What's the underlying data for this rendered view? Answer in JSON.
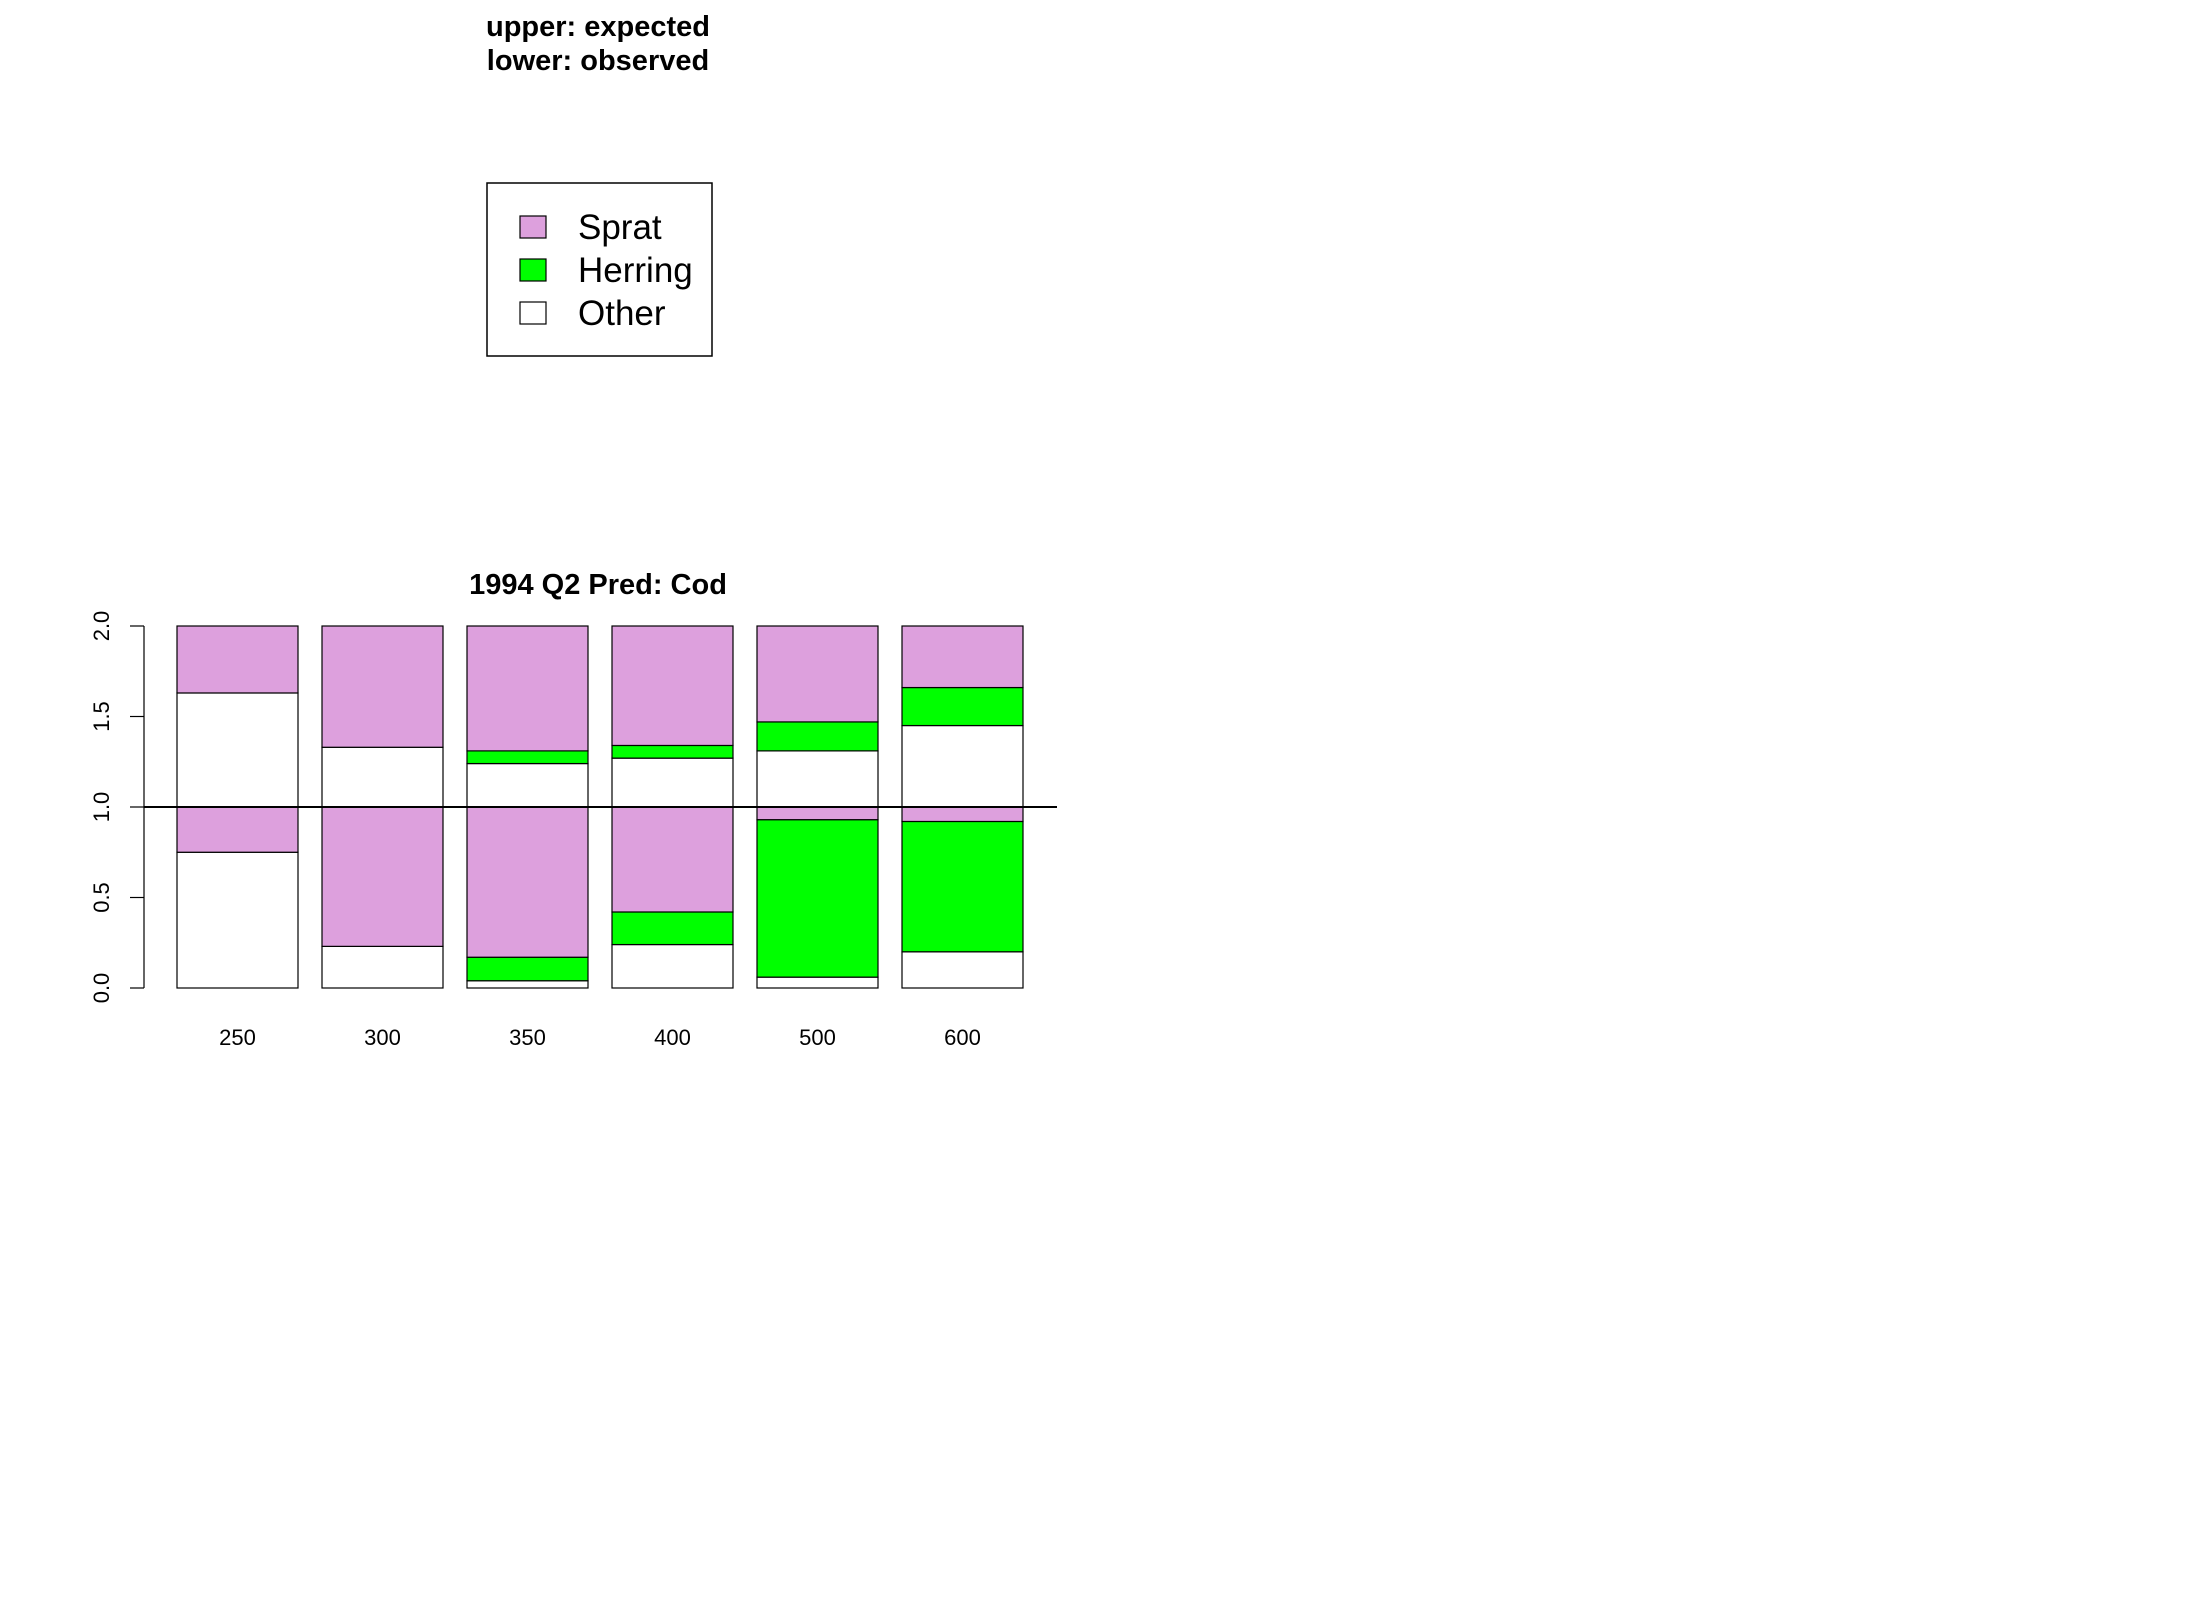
{
  "header": {
    "line1": "upper: expected",
    "line2": "lower: observed"
  },
  "legend": {
    "items": [
      {
        "label": "Sprat",
        "color": "#dda0dd"
      },
      {
        "label": "Herring",
        "color": "#00ff00"
      },
      {
        "label": "Other",
        "color": "#ffffff"
      }
    ]
  },
  "chart_data": {
    "type": "bar",
    "title": "1994 Q2  Pred: Cod",
    "xlabel": "",
    "ylabel": "",
    "ylim": [
      0,
      2
    ],
    "yticks": [
      "0.0",
      "0.5",
      "1.0",
      "1.5",
      "2.0"
    ],
    "reference_line": 1.0,
    "categories": [
      "250",
      "300",
      "350",
      "400",
      "500",
      "600"
    ],
    "stack_order": [
      "Other",
      "Herring",
      "Sprat"
    ],
    "expected": [
      {
        "name": "Other",
        "values": [
          0.63,
          0.33,
          0.24,
          0.27,
          0.31,
          0.45
        ]
      },
      {
        "name": "Herring",
        "values": [
          0.0,
          0.0,
          0.07,
          0.07,
          0.16,
          0.21
        ]
      },
      {
        "name": "Sprat",
        "values": [
          0.37,
          0.67,
          0.69,
          0.66,
          0.53,
          0.34
        ]
      }
    ],
    "observed": [
      {
        "name": "Other",
        "values": [
          0.75,
          0.23,
          0.04,
          0.24,
          0.06,
          0.2
        ]
      },
      {
        "name": "Herring",
        "values": [
          0.0,
          0.0,
          0.13,
          0.18,
          0.87,
          0.72
        ]
      },
      {
        "name": "Sprat",
        "values": [
          0.25,
          0.77,
          0.83,
          0.58,
          0.07,
          0.08
        ]
      }
    ]
  }
}
